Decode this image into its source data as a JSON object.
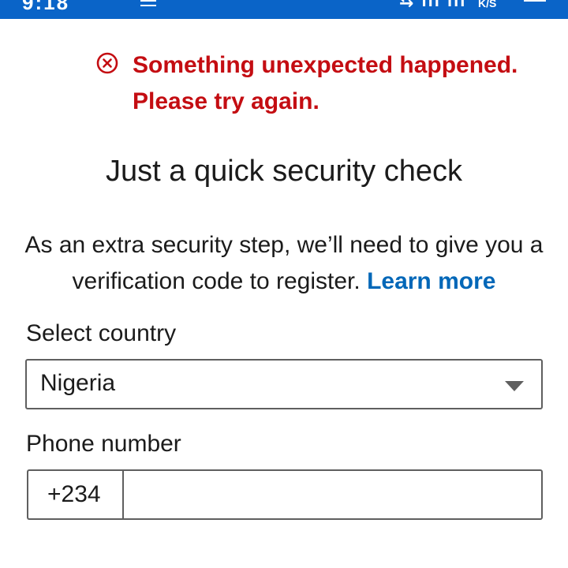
{
  "status_bar": {
    "time": "9:18",
    "speed_unit": "K/S"
  },
  "error": {
    "icon": "circle-x-icon",
    "message": "Something unexpected happened. Please try again.",
    "color": "#c40d12"
  },
  "title": "Just a quick security check",
  "description": {
    "text": "As an extra security step, we’ll need to give you a verification code to register. ",
    "link_label": "Learn more",
    "link_color": "#0067b8"
  },
  "country": {
    "label": "Select country",
    "selected": "Nigeria"
  },
  "phone": {
    "label": "Phone number",
    "country_code": "+234",
    "value": ""
  },
  "colors": {
    "status_bar": "#0a64c8",
    "border": "#5f5f5f"
  }
}
